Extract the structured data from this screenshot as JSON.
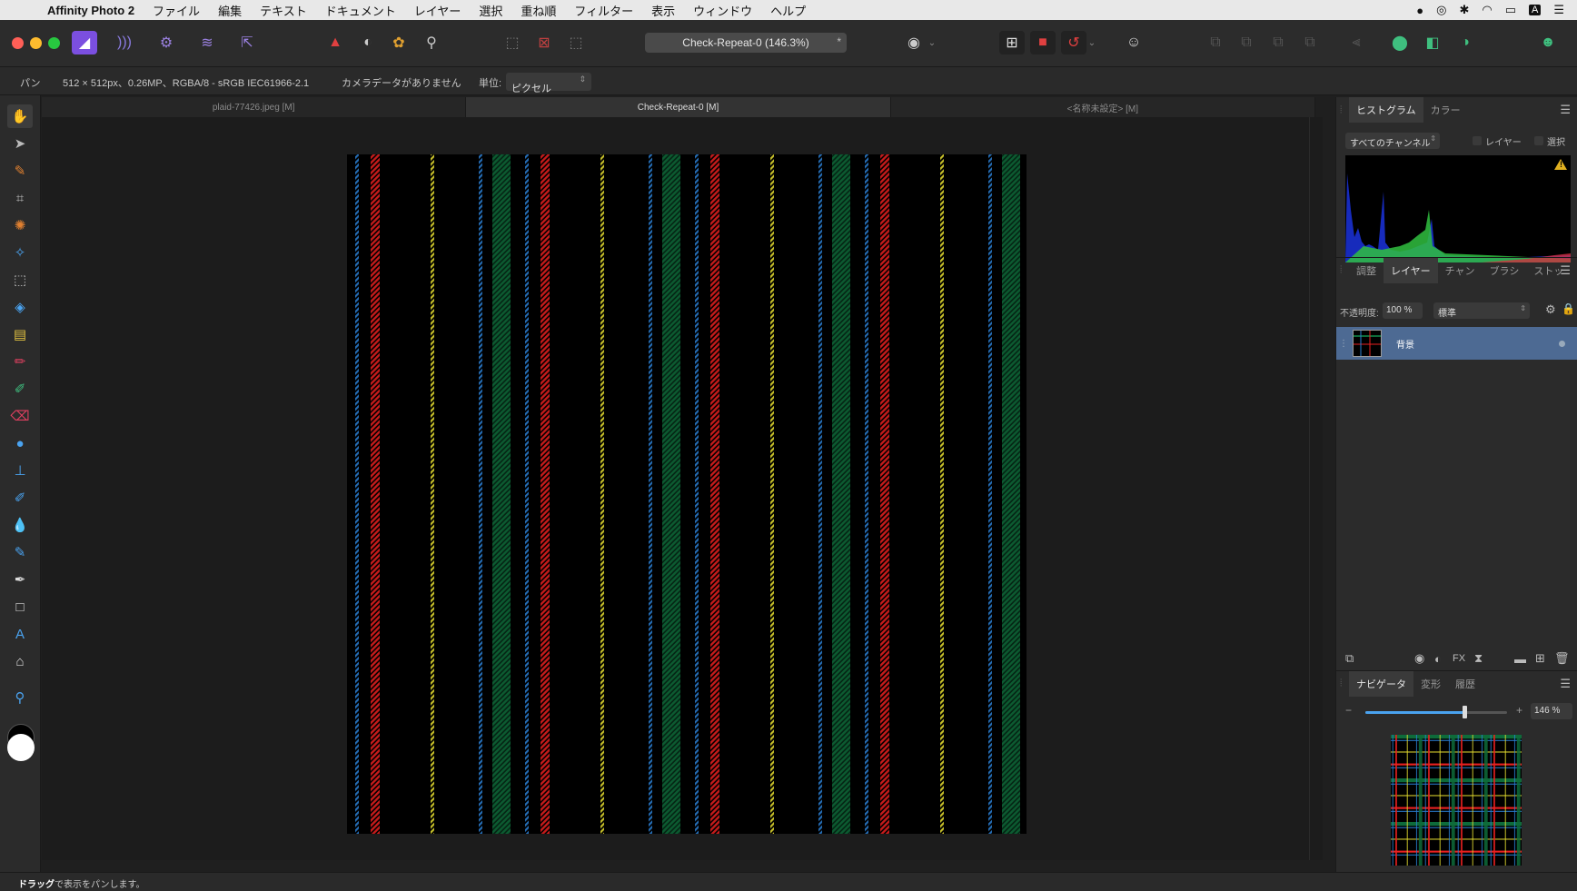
{
  "menubar": {
    "app_name": "Affinity Photo 2",
    "items": [
      "ファイル",
      "編集",
      "テキスト",
      "ドキュメント",
      "レイヤー",
      "選択",
      "重ね順",
      "フィルター",
      "表示",
      "ウィンドウ",
      "ヘルプ"
    ]
  },
  "toolbar": {
    "document_title": "Check-Repeat-0 (146.3%)",
    "star": "*"
  },
  "contextbar": {
    "tool_name": "パン",
    "image_info": "512 × 512px、0.26MP、RGBA/8 - sRGB IEC61966-2.1",
    "camera_info": "カメラデータがありません",
    "unit_label": "単位:",
    "unit_value": "ピクセル"
  },
  "doctabs": [
    "plaid-77426.jpeg [M]",
    "Check-Repeat-0 [M]",
    "<名称未設定> [M]"
  ],
  "panels": {
    "histogram": {
      "tabs": [
        "ヒストグラム",
        "カラー"
      ],
      "channel_select": "すべてのチャンネル",
      "layer_checkbox": "レイヤー",
      "selection_checkbox": "選択",
      "warning": "!"
    },
    "layers": {
      "tabs": [
        "調整",
        "レイヤー",
        "チャン",
        "ブラシ",
        "ストッ"
      ],
      "opacity_label": "不透明度:",
      "opacity_value": "100 %",
      "blend_mode": "標準",
      "layer_name": "背景"
    },
    "navigator": {
      "tabs": [
        "ナビゲータ",
        "変形",
        "履歴"
      ],
      "zoom_value": "146 %",
      "zoom_level": 0.7
    }
  },
  "statusbar": {
    "bold": "ドラッグ",
    "text": "で表示をパンします。"
  },
  "colors": {
    "accent": "#4d6a93",
    "plaid_red": "#e82020",
    "plaid_green": "#0e6b3a",
    "plaid_blue": "#2a7fd4",
    "plaid_yellow": "#e8e030"
  }
}
